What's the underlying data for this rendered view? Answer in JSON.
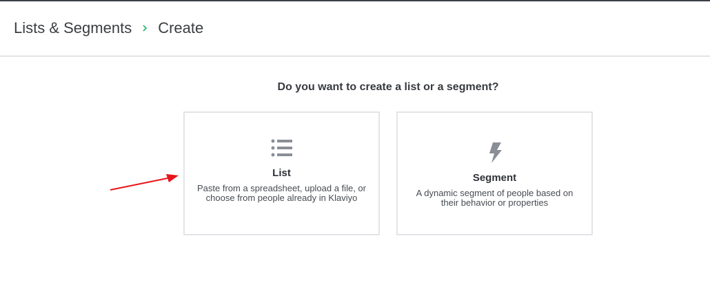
{
  "breadcrumb": {
    "parent": "Lists & Segments",
    "current": "Create"
  },
  "prompt": "Do you want to create a list or a segment?",
  "options": [
    {
      "title": "List",
      "description": "Paste from a spreadsheet, upload a file, or choose from people already in Klaviyo",
      "icon": "list-icon"
    },
    {
      "title": "Segment",
      "description": "A dynamic segment of people based on their behavior or properties",
      "icon": "lightning-icon"
    }
  ],
  "colors": {
    "accent": "#2bb673",
    "annotation_arrow": "#e8141b",
    "icon": "#8a8f96"
  }
}
